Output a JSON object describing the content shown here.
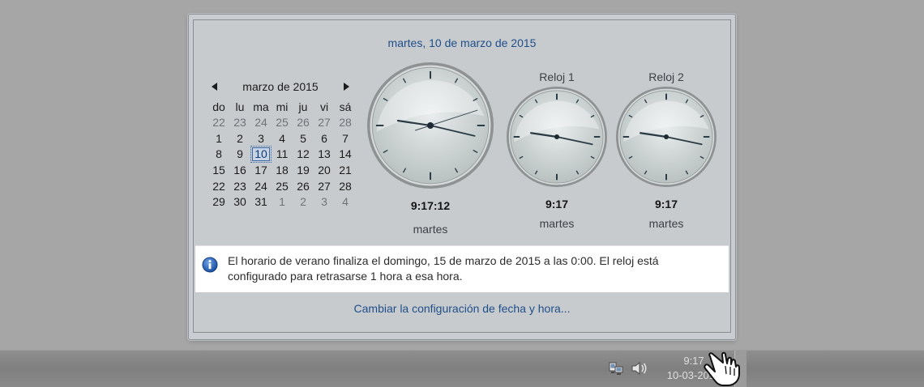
{
  "flyout": {
    "date_header": "martes, 10 de marzo de 2015",
    "settings_link": "Cambiar la configuración de fecha y hora..."
  },
  "calendar": {
    "month_title": "marzo de 2015",
    "prev_icon": "triangle-left-icon",
    "next_icon": "triangle-right-icon",
    "weekdays": [
      "do",
      "lu",
      "ma",
      "mi",
      "ju",
      "vi",
      "sá"
    ],
    "weeks": [
      [
        "22",
        "23",
        "24",
        "25",
        "26",
        "27",
        "28"
      ],
      [
        "1",
        "2",
        "3",
        "4",
        "5",
        "6",
        "7"
      ],
      [
        "8",
        "9",
        "10",
        "11",
        "12",
        "13",
        "14"
      ],
      [
        "15",
        "16",
        "17",
        "18",
        "19",
        "20",
        "21"
      ],
      [
        "22",
        "23",
        "24",
        "25",
        "26",
        "27",
        "28"
      ],
      [
        "29",
        "30",
        "31",
        "1",
        "2",
        "3",
        "4"
      ]
    ],
    "today": "10"
  },
  "clocks": {
    "main": {
      "caption": "",
      "time": "9:17:12",
      "day": "martes",
      "hour": 9,
      "minute": 17,
      "second": 12
    },
    "clock1": {
      "caption": "Reloj 1",
      "time": "9:17",
      "day": "martes",
      "hour": 9,
      "minute": 17
    },
    "clock2": {
      "caption": "Reloj 2",
      "time": "9:17",
      "day": "martes",
      "hour": 9,
      "minute": 17
    }
  },
  "info": {
    "icon": "info-icon",
    "line1": "El horario de verano finaliza el domingo, 15 de marzo de 2015 a las 0:00. El reloj está",
    "line2": "configurado para retrasarse 1 hora a esa hora."
  },
  "taskbar": {
    "network_icon": "network-icon",
    "volume_icon": "speaker-icon",
    "time": "9:17",
    "date": "10-03-2015"
  },
  "colors": {
    "link": "#1f4f8a",
    "info_blue": "#1e5fb4"
  }
}
